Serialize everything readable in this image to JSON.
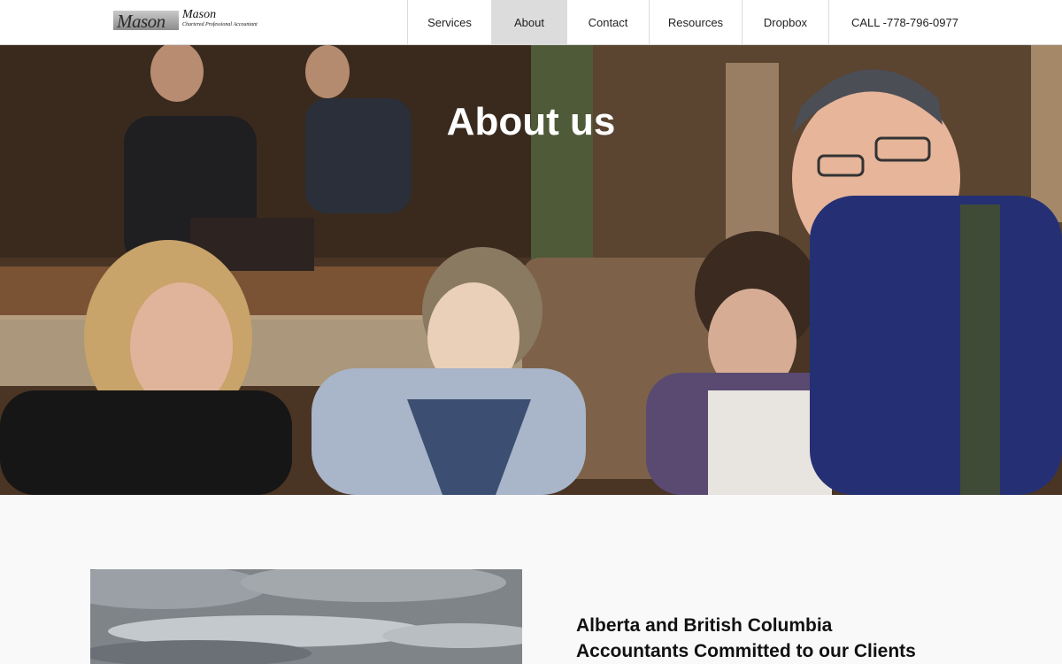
{
  "header": {
    "logo": {
      "mark": "Mason",
      "name": "Mason",
      "tagline": "Chartered Professional Accountant"
    },
    "nav": [
      {
        "label": "Services",
        "active": false
      },
      {
        "label": "About",
        "active": true
      },
      {
        "label": "Contact",
        "active": false
      },
      {
        "label": "Resources",
        "active": false
      },
      {
        "label": "Dropbox",
        "active": false
      },
      {
        "label": "CALL -778-796-0977",
        "active": false
      }
    ]
  },
  "hero": {
    "title": "About us",
    "image": "group-photo-in-restaurant"
  },
  "main": {
    "photo": "cloudy-sky-landscape",
    "headline_line1": "Alberta and British Columbia",
    "headline_line2": "Accountants Committed to our Clients"
  },
  "colors": {
    "active_nav_bg": "#dcdcdc",
    "header_bg": "#ffffff",
    "page_bg": "#f9f9f9"
  }
}
